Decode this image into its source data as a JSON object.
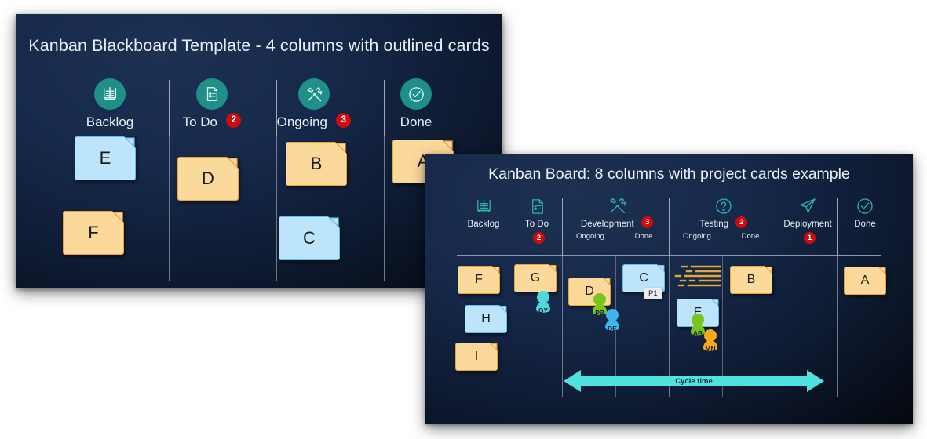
{
  "colors": {
    "slide_bg_dark": "#0e1b33",
    "accent_teal": "#1f9089",
    "badge_red": "#d00b0b",
    "card_yellow": "#fbd99b",
    "card_yellow_border": "#e8a33d",
    "card_blue": "#bce4fb",
    "card_blue_border": "#63bdf0",
    "cycle_arrow": "#4fe3e0",
    "avatar_teal": "#4fd8dd",
    "avatar_green": "#7ac51c",
    "avatar_blue": "#3fb5ef",
    "avatar_orange": "#f7a81b"
  },
  "slide1": {
    "title": "Kanban Blackboard Template - 4 columns with outlined cards",
    "columns": [
      {
        "label": "Backlog",
        "icon": "backlog-list-icon",
        "badge": ""
      },
      {
        "label": "To Do",
        "icon": "todo-document-icon",
        "badge": "2"
      },
      {
        "label": "Ongoing",
        "icon": "tools-icon",
        "badge": "3"
      },
      {
        "label": "Done",
        "icon": "check-circle-icon",
        "badge": ""
      }
    ],
    "cards": [
      {
        "label": "E",
        "color": "blue",
        "col": 0
      },
      {
        "label": "F",
        "color": "yellow",
        "col": 0
      },
      {
        "label": "D",
        "color": "yellow",
        "col": 1
      },
      {
        "label": "B",
        "color": "yellow",
        "col": 2
      },
      {
        "label": "C",
        "color": "blue",
        "col": 2
      },
      {
        "label": "A",
        "color": "yellow",
        "col": 3
      }
    ]
  },
  "slide2": {
    "title": "Kanban Board: 8 columns with project cards example",
    "columns": [
      {
        "label": "Backlog",
        "icon": "backlog-list-icon",
        "badge": "",
        "subs": []
      },
      {
        "label": "To Do",
        "icon": "todo-document-icon",
        "badge": "2",
        "subs": []
      },
      {
        "label": "Development",
        "icon": "tools-icon",
        "badge": "3",
        "subs": [
          "Ongoing",
          "Done"
        ]
      },
      {
        "label": "Testing",
        "icon": "question-circle-icon",
        "badge": "2",
        "subs": [
          "Ongoing",
          "Done"
        ]
      },
      {
        "label": "Deployment",
        "icon": "paper-plane-icon",
        "badge": "1",
        "subs": []
      },
      {
        "label": "Done",
        "icon": "check-circle-icon",
        "badge": "",
        "subs": []
      }
    ],
    "cards": [
      {
        "label": "F",
        "color": "yellow"
      },
      {
        "label": "H",
        "color": "blue"
      },
      {
        "label": "I",
        "color": "yellow"
      },
      {
        "label": "G",
        "color": "yellow"
      },
      {
        "label": "D",
        "color": "yellow"
      },
      {
        "label": "C",
        "color": "blue"
      },
      {
        "label": "E",
        "color": "blue"
      },
      {
        "label": "B",
        "color": "yellow"
      },
      {
        "label": "A",
        "color": "yellow"
      }
    ],
    "avatars": [
      {
        "initials": "GY",
        "color": "#4fd8dd"
      },
      {
        "initials": "PB",
        "color": "#7ac51c"
      },
      {
        "initials": "DE",
        "color": "#3fb5ef"
      },
      {
        "initials": "AB",
        "color": "#7ac51c"
      },
      {
        "initials": "MN",
        "color": "#f7a81b"
      }
    ],
    "priority_tag": "P1",
    "cycle_time_label": "Cycle time"
  }
}
